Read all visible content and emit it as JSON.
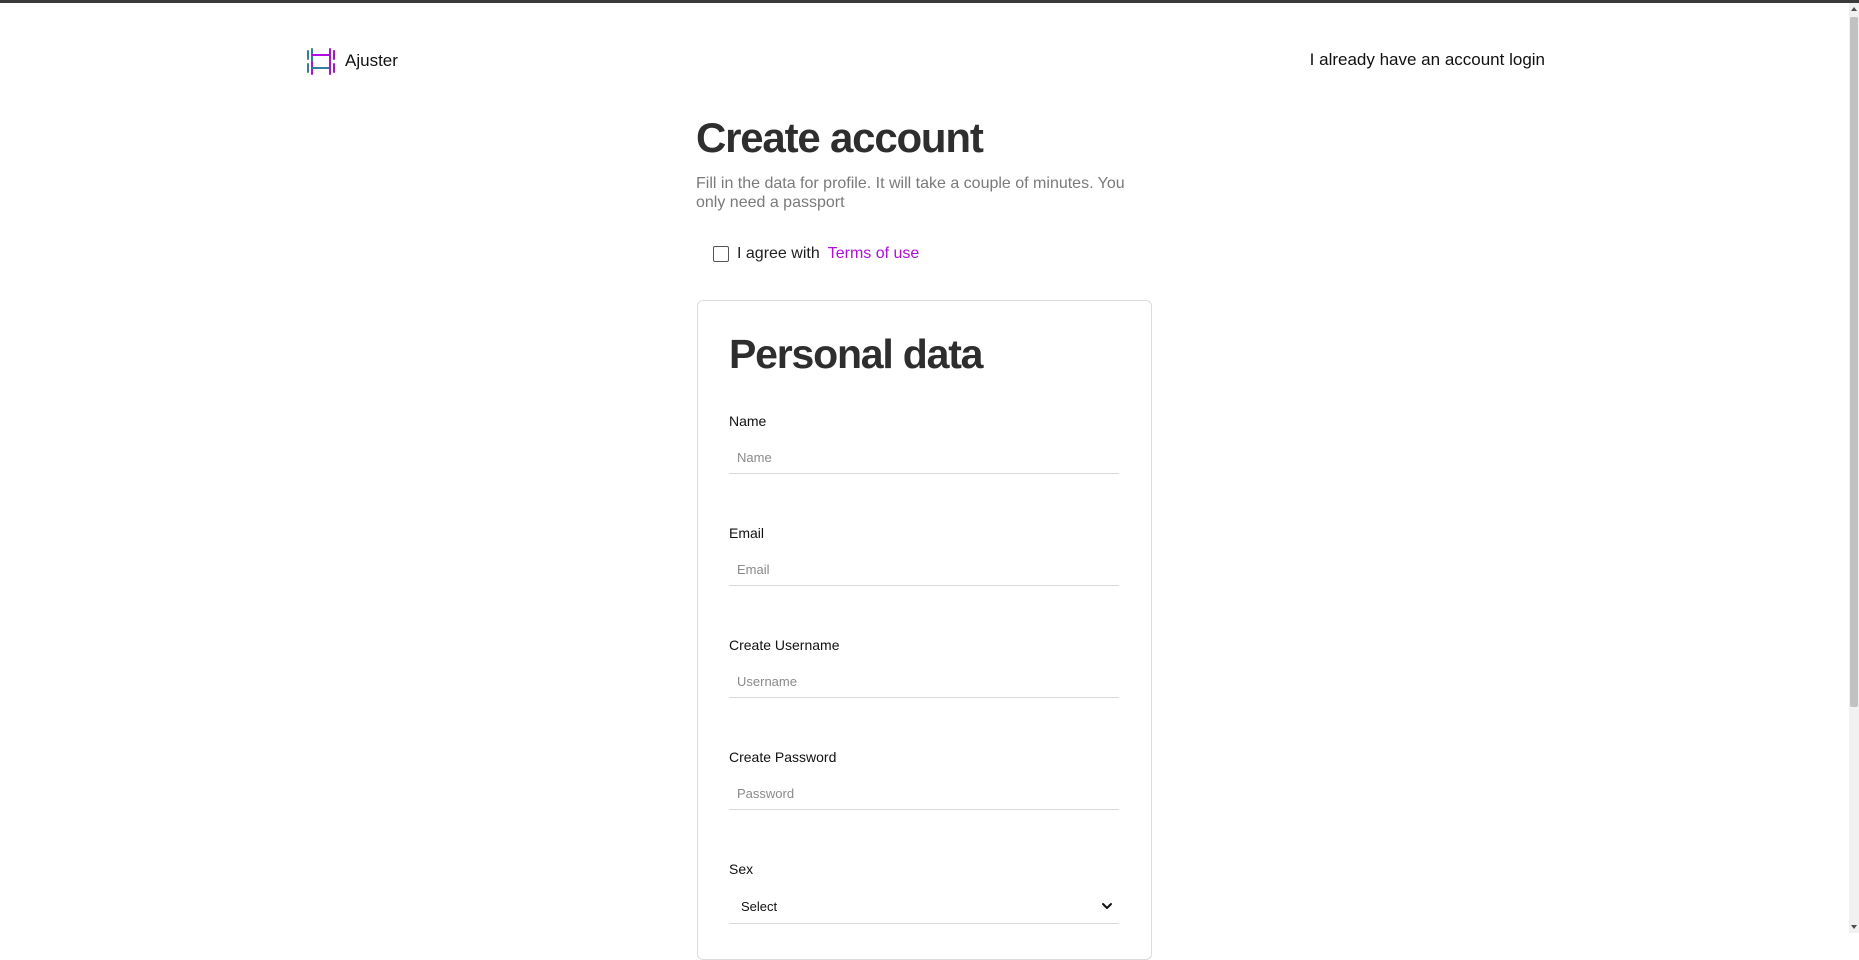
{
  "app": {
    "brand": "Ajuster",
    "login_link": "I already have an account login"
  },
  "page": {
    "title": "Create account",
    "subtitle": "Fill in the data for profile. It will take a couple of minutes. You only need a passport",
    "agree_text": "I agree with",
    "terms_link": "Terms of use"
  },
  "form": {
    "section_title": "Personal data",
    "name": {
      "label": "Name",
      "placeholder": "Name",
      "value": ""
    },
    "email": {
      "label": "Email",
      "placeholder": "Email",
      "value": ""
    },
    "username": {
      "label": "Create Username",
      "placeholder": "Username",
      "value": ""
    },
    "password": {
      "label": "Create Password",
      "placeholder": "Password",
      "value": ""
    },
    "sex": {
      "label": "Sex",
      "selected": "Select"
    }
  },
  "colors": {
    "accent": "#b00ee0",
    "title": "#2e2e2e",
    "subtitle": "#7a7a7a",
    "logo_teal": "#2f7f9e",
    "logo_purple": "#b00ee0"
  },
  "icons": {
    "logo": "dumbbell-logo-icon",
    "select_arrow": "chevron-down-icon"
  }
}
